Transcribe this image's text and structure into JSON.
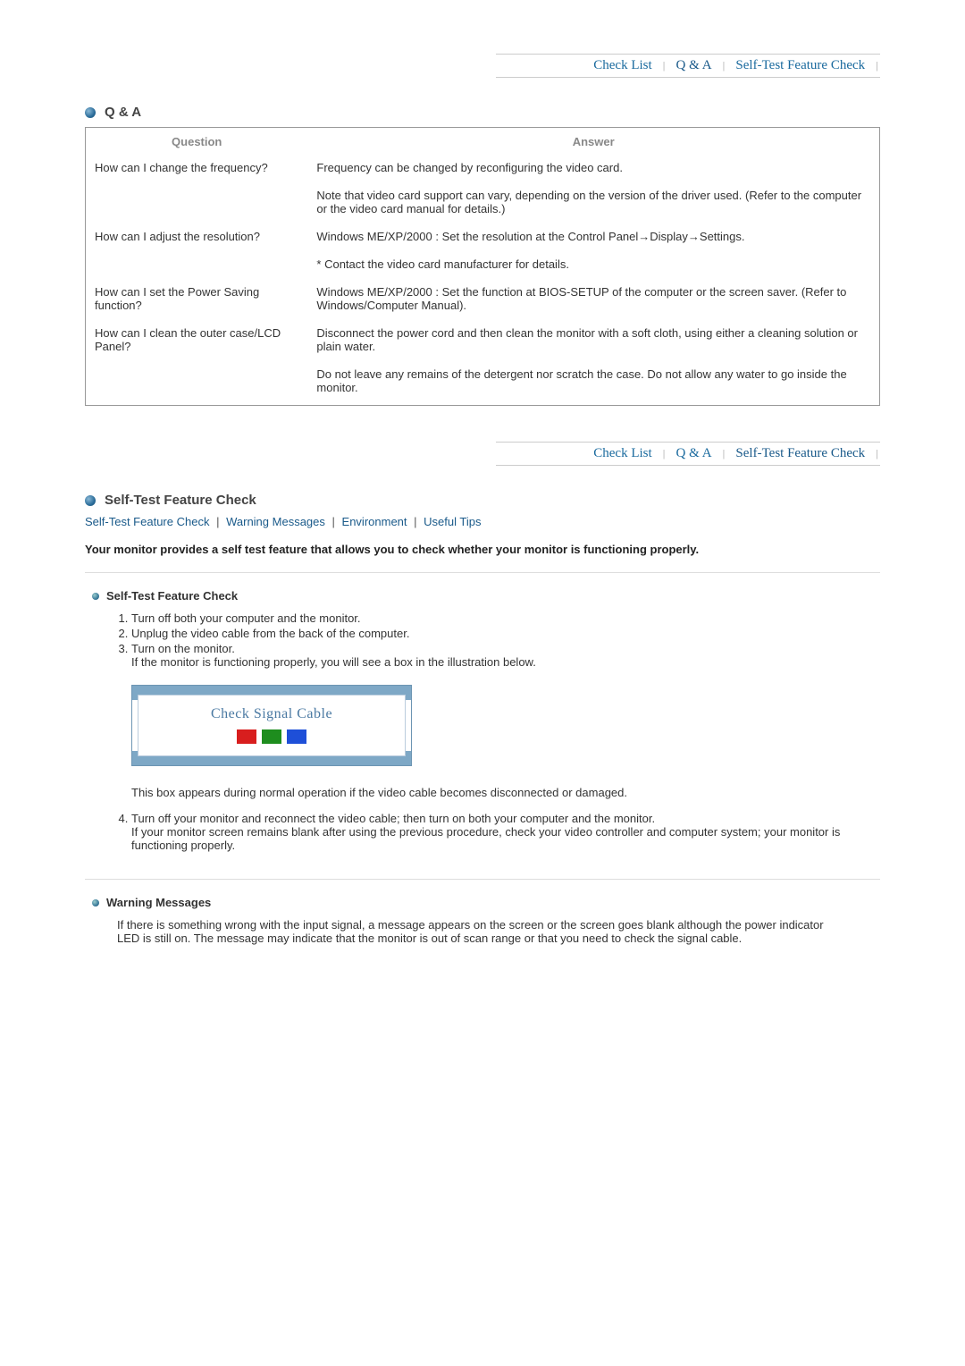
{
  "nav": {
    "items": [
      {
        "label": "Check List"
      },
      {
        "label": "Q & A"
      },
      {
        "label": "Self-Test Feature Check"
      }
    ]
  },
  "qa_section": {
    "title": "Q & A",
    "headers": {
      "q": "Question",
      "a": "Answer"
    },
    "rows": [
      {
        "q": "How can I change the frequency?",
        "a1": "Frequency can be changed by reconfiguring the video card.",
        "a2": "Note that video card support can vary, depending on the version of the driver used. (Refer to the computer or the video card manual for details.)"
      },
      {
        "q": "How can I adjust the resolution?",
        "a1": "Windows ME/XP/2000 : Set the resolution at the Control Panel→Display→Settings.",
        "a2": "* Contact the video card manufacturer for details."
      },
      {
        "q": "How can I set the Power Saving function?",
        "a1": "Windows ME/XP/2000 : Set the function at BIOS-SETUP of the computer or the screen saver. (Refer to Windows/Computer Manual)."
      },
      {
        "q": "How can I clean the outer case/LCD Panel?",
        "a1": "Disconnect the power cord and then clean the monitor with a soft cloth, using either a cleaning solution or plain water.",
        "a2": "Do not leave any remains of the detergent nor scratch the case. Do not allow any water to go inside the monitor."
      }
    ]
  },
  "selftest_section": {
    "title": "Self-Test Feature Check",
    "anchors": [
      "Self-Test Feature Check",
      "Warning Messages",
      "Environment",
      "Useful Tips"
    ],
    "intro": "Your monitor provides a self test feature that allows you to check whether your monitor is functioning properly.",
    "sub1_title": "Self-Test Feature Check",
    "steps": {
      "s1": "Turn off both your computer and the monitor.",
      "s2": "Unplug the video cable from the back of the computer.",
      "s3a": "Turn on the monitor.",
      "s3b": "If the monitor is functioning properly, you will see a box in the illustration below.",
      "s3_note": "This box appears during normal operation if the video cable becomes disconnected or damaged.",
      "s4a": "Turn off your monitor and reconnect the video cable; then turn on both your computer and the monitor.",
      "s4b": "If your monitor screen remains blank after using the previous procedure, check your video controller and computer system; your monitor is functioning properly."
    },
    "illustration_label": "Check Signal Cable",
    "sub2_title": "Warning Messages",
    "warning_para": "If there is something wrong with the input signal, a message appears on the screen or the screen goes blank although the power indicator LED is still on. The message may indicate that the monitor is out of scan range or that you need to check the signal cable."
  }
}
